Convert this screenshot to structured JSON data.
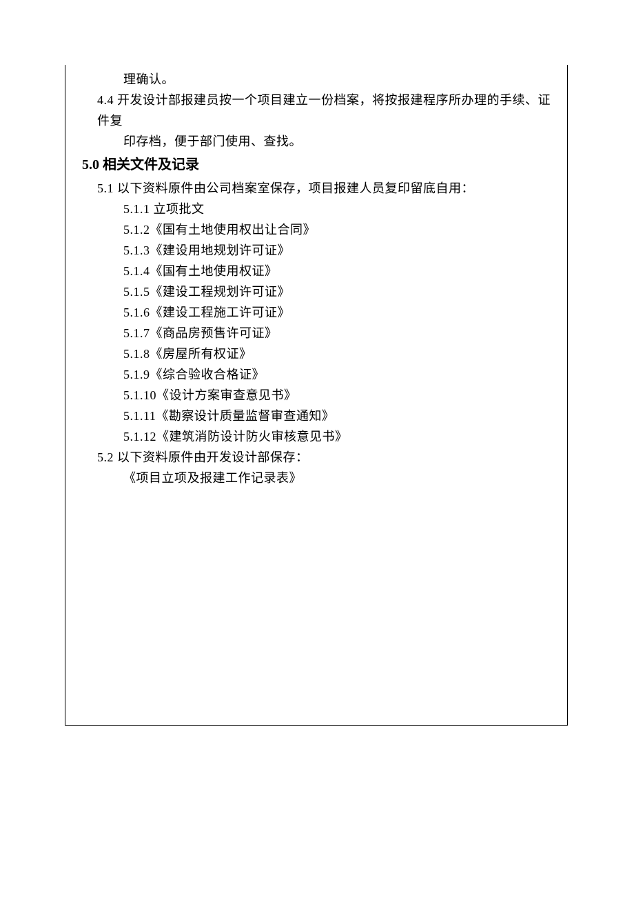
{
  "sec4": {
    "cont_line": "理确认。",
    "item_4_4_a": "4.4 开发设计部报建员按一个项目建立一份档案，将按报建程序所办理的手续、证件复",
    "item_4_4_b": "印存档，便于部门使用、查找。"
  },
  "heading5": "5.0 相关文件及记录",
  "sec5": {
    "item_5_1": "5.1 以下资料原件由公司档案室保存，项目报建人员复印留底自用：",
    "subs": {
      "s1": "5.1.1 立项批文",
      "s2": "5.1.2《国有土地使用权出让合同》",
      "s3": "5.1.3《建设用地规划许可证》",
      "s4": "5.1.4《国有土地使用权证》",
      "s5": "5.1.5《建设工程规划许可证》",
      "s6": "5.1.6《建设工程施工许可证》",
      "s7": "5.1.7《商品房预售许可证》",
      "s8": "5.1.8《房屋所有权证》",
      "s9": "5.1.9《综合验收合格证》",
      "s10": "5.1.10《设计方案审查意见书》",
      "s11": "5.1.11《勘察设计质量监督审查通知》",
      "s12": "5.1.12《建筑消防设计防火审核意见书》"
    },
    "item_5_2": "5.2 以下资料原件由开发设计部保存：",
    "item_5_2_sub": "《项目立项及报建工作记录表》"
  }
}
